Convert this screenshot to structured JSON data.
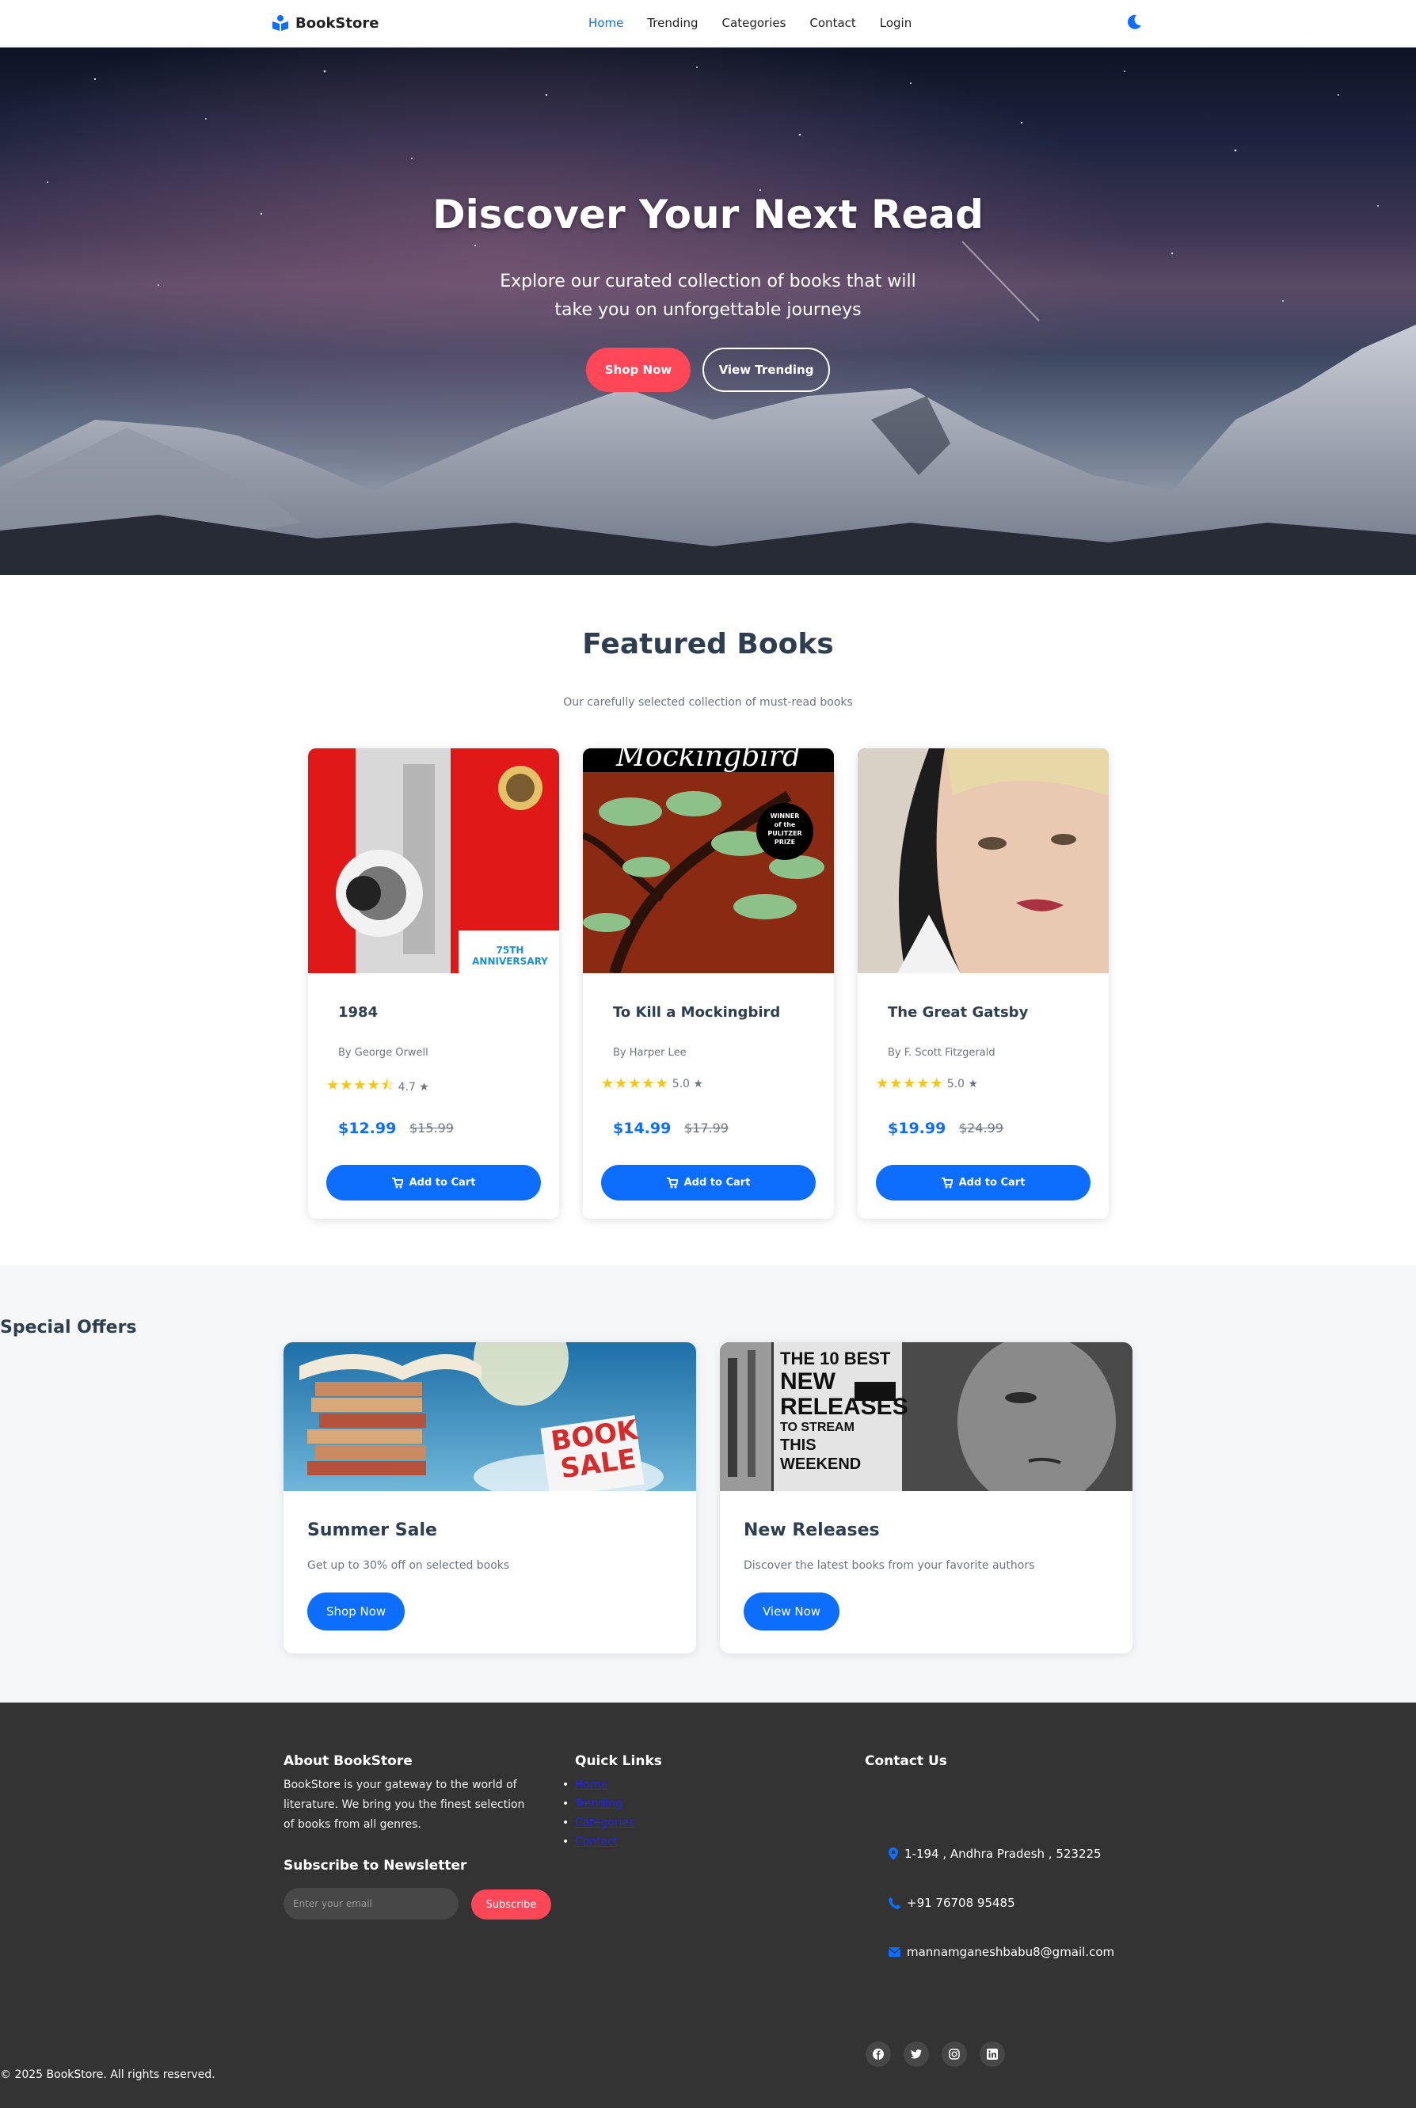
{
  "nav": {
    "brand": "BookStore",
    "links": [
      "Home",
      "Trending",
      "Categories",
      "Contact",
      "Login"
    ],
    "active": "Home"
  },
  "hero": {
    "title": "Discover Your Next Read",
    "subtitle": "Explore our curated collection of books that will take you on unforgettable journeys",
    "shop_button": "Shop Now",
    "trending_button": "View Trending"
  },
  "featured": {
    "title": "Featured Books",
    "subtitle": "Our carefully selected collection of must-read books",
    "cart_label": "Add to Cart",
    "books": [
      {
        "title": "1984",
        "author": "By George Orwell",
        "rating": "4.7 ★",
        "stars": 4.7,
        "price": "$12.99",
        "old_price": "$15.99"
      },
      {
        "title": "To Kill a Mockingbird",
        "author": "By Harper Lee",
        "rating": "5.0 ★",
        "stars": 5.0,
        "price": "$14.99",
        "old_price": "$17.99"
      },
      {
        "title": "The Great Gatsby",
        "author": "By F. Scott Fitzgerald",
        "rating": "5.0 ★",
        "stars": 5.0,
        "price": "$19.99",
        "old_price": "$24.99"
      }
    ],
    "cover_text": {
      "b1_badge": "75TH ANNIVERSARY",
      "b2_title": "Mockingbird",
      "b2_badge": [
        "WINNER",
        "of the",
        "PULITZER",
        "PRIZE"
      ]
    }
  },
  "offers": {
    "title": "Special Offers",
    "items": [
      {
        "title": "Summer Sale",
        "desc": "Get up to 30% off on selected books",
        "button": "Shop Now",
        "image_text": [
          "BOOK",
          "SALE"
        ]
      },
      {
        "title": "New Releases",
        "desc": "Discover the latest books from your favorite authors",
        "button": "View Now",
        "image_text": [
          "THE 10 BEST",
          "NEW",
          "RELEASES",
          "TO STREAM",
          "THIS WEEKEND"
        ]
      }
    ]
  },
  "footer": {
    "about_title": "About BookStore",
    "about_text": "BookStore is your gateway to the world of literature. We bring you the finest selection of books from all genres.",
    "links_title": "Quick Links",
    "links": [
      "Home",
      "Trending",
      "Categories",
      "Contact"
    ],
    "contact_title": "Contact Us",
    "address": "1-194 , Andhra Pradesh , 523225",
    "phone": "+91 76708 95485",
    "email": "mannamganeshbabu8@gmail.com",
    "newsletter_title": "Subscribe to Newsletter",
    "newsletter_placeholder": "Enter your email",
    "subscribe": "Subscribe",
    "copyright": "© 2025 BookStore. All rights reserved.",
    "socials": [
      "facebook-icon",
      "twitter-icon",
      "instagram-icon",
      "linkedin-icon"
    ]
  },
  "colors": {
    "primary": "#0d6efd",
    "accent": "#ff4757",
    "star": "#f5c518",
    "footer_bg": "#333333"
  }
}
